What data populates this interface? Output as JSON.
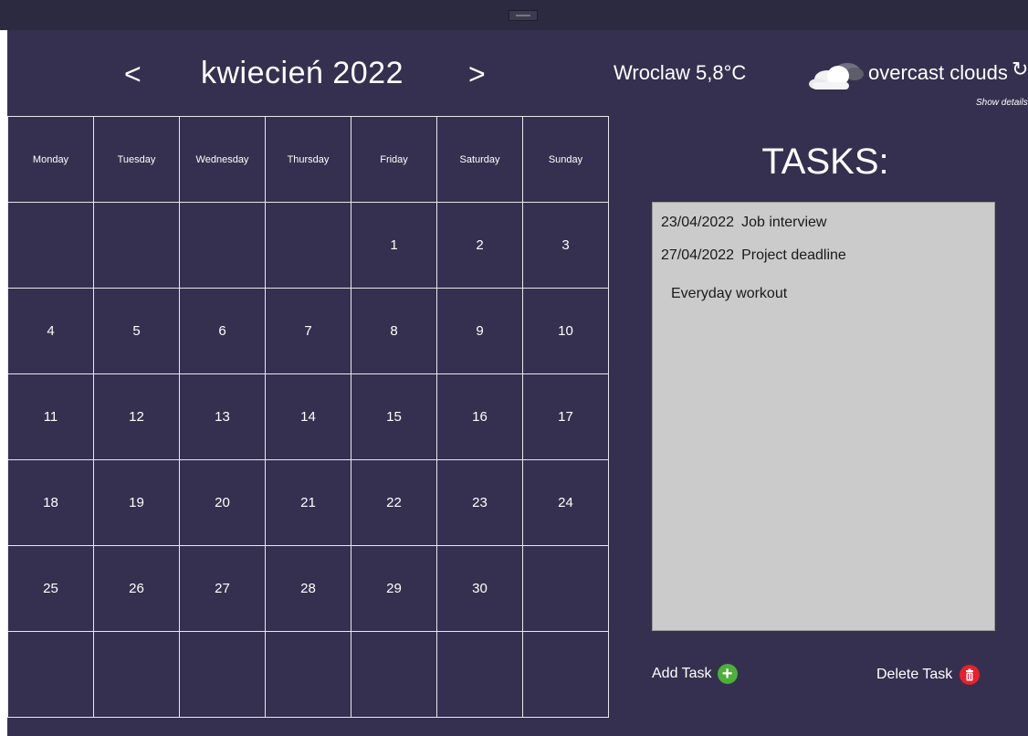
{
  "nav": {
    "prev": "<",
    "next": ">",
    "month_label": "kwiecień 2022"
  },
  "weather": {
    "city_temp": "Wroclaw 5,8°C",
    "description": "overcast clouds",
    "refresh_icon": "refresh-icon",
    "details_link": "Show details"
  },
  "calendar": {
    "weekdays": [
      "Monday",
      "Tuesday",
      "Wednesday",
      "Thursday",
      "Friday",
      "Saturday",
      "Sunday"
    ],
    "weeks": [
      [
        "",
        "",
        "",
        "",
        "1",
        "2",
        "3"
      ],
      [
        "4",
        "5",
        "6",
        "7",
        "8",
        "9",
        "10"
      ],
      [
        "11",
        "12",
        "13",
        "14",
        "15",
        "16",
        "17"
      ],
      [
        "18",
        "19",
        "20",
        "21",
        "22",
        "23",
        "24"
      ],
      [
        "25",
        "26",
        "27",
        "28",
        "29",
        "30",
        ""
      ],
      [
        "",
        "",
        "",
        "",
        "",
        "",
        ""
      ]
    ]
  },
  "tasks": {
    "title": "TASKS:",
    "items": [
      {
        "date": "23/04/2022",
        "name": "Job interview"
      },
      {
        "date": "27/04/2022",
        "name": "Project deadline"
      },
      {
        "date": "",
        "name": "Everyday workout"
      }
    ],
    "add_label": "Add Task",
    "delete_label": "Delete Task"
  },
  "colors": {
    "background": "#35304f",
    "titlebar": "#2b2a41",
    "task_list_bg": "#cbcbcb",
    "add_icon": "#4caf3a",
    "delete_icon": "#e8202a"
  }
}
